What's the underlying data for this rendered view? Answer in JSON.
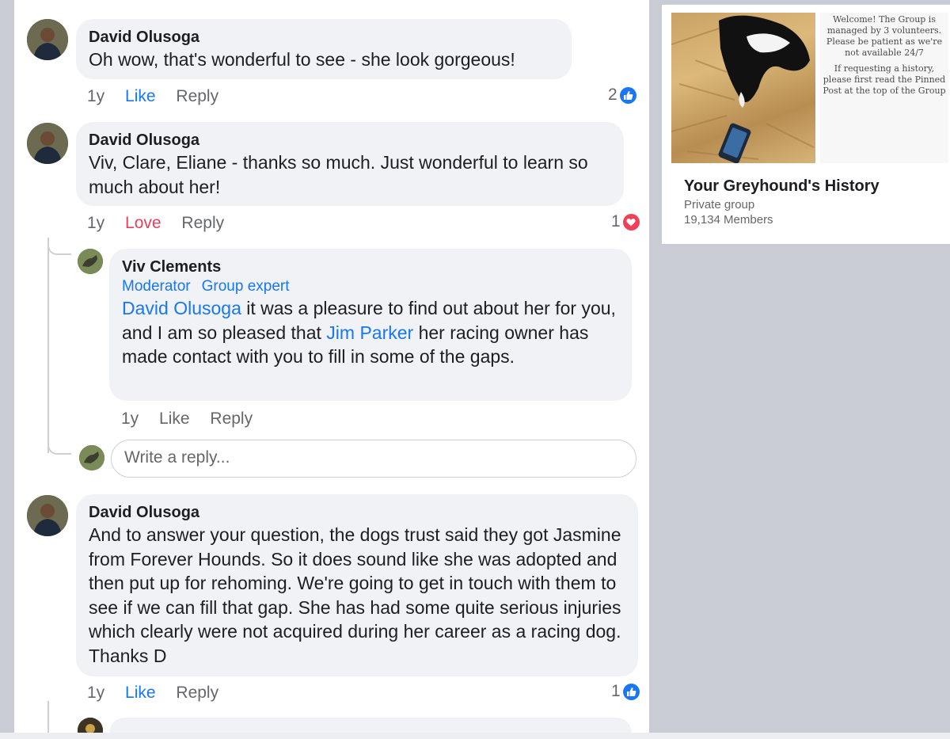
{
  "comments": [
    {
      "author": "David Olusoga",
      "text": "Oh wow, that's wonderful to see - she look gorgeous!",
      "time": "1y",
      "action": "Like",
      "reply": "Reply",
      "count": "2",
      "reaction": "like"
    },
    {
      "author": "David Olusoga",
      "text": "Viv, Clare, Eliane  - thanks so much. Just wonderful to learn so much about her!",
      "time": "1y",
      "action": "Love",
      "reply": "Reply",
      "count": "1",
      "reaction": "love"
    },
    {
      "author": "David Olusoga",
      "text": "And to answer your question, the dogs trust said they got Jasmine from Forever Hounds. So it does sound like she was adopted and then put up for rehoming. We're going to get in touch with them to see if we can fill that gap. She has had some quite serious injuries which clearly were not acquired during her career as a racing dog. Thanks D",
      "time": "1y",
      "action": "Like",
      "reply": "Reply",
      "count": "1",
      "reaction": "like"
    }
  ],
  "reply": {
    "author": "Viv Clements",
    "badges": [
      "Moderator",
      "Group expert"
    ],
    "mention1": "David Olusoga",
    "text1": " it was a pleasure to find out about her for you, and I am so pleased that ",
    "mention2": "Jim Parker",
    "text2": " her racing owner has made contact with you to fill in some of the gaps.",
    "time": "1y",
    "action": "Like",
    "reply": "Reply"
  },
  "reply_input": {
    "placeholder": "Write a reply..."
  },
  "group": {
    "name": "Your Greyhound's History",
    "type": "Private group",
    "members": "19,134 Members",
    "notice_welcome": "Welcome! The Group is managed by 3 volunteers. Please be patient as we're not available 24/7",
    "notice_history": "If requesting a history, please first read the Pinned Post at the top of the Group"
  },
  "colors": {
    "link": "#1877f2",
    "love": "#e4405f",
    "bubble": "#f0f2f5",
    "meta": "#65676b"
  },
  "icons": {
    "like_reaction": "thumbs-up-icon",
    "love_reaction": "heart-icon"
  }
}
